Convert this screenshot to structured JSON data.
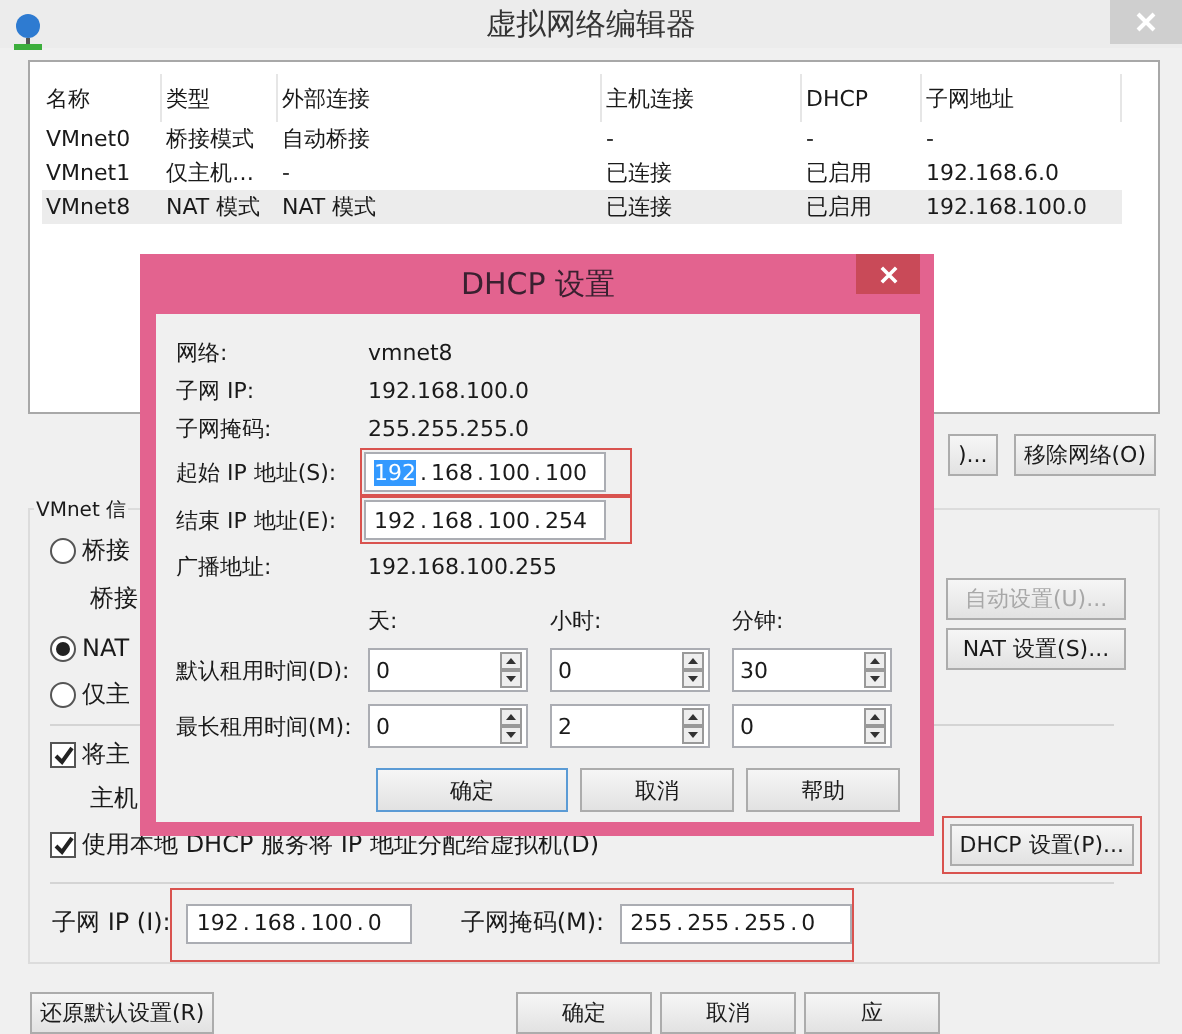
{
  "window": {
    "title": "虚拟网络编辑器"
  },
  "table": {
    "columns": [
      "名称",
      "类型",
      "外部连接",
      "主机连接",
      "DHCP",
      "子网地址"
    ],
    "rows": [
      {
        "cells": [
          "VMnet0",
          "桥接模式",
          "自动桥接",
          "-",
          "-",
          "-"
        ],
        "selected": false
      },
      {
        "cells": [
          "VMnet1",
          "仅主机…",
          "-",
          "已连接",
          "已启用",
          "192.168.6.0"
        ],
        "selected": false
      },
      {
        "cells": [
          "VMnet8",
          "NAT 模式",
          "NAT 模式",
          "已连接",
          "已启用",
          "192.168.100.0"
        ],
        "selected": true
      }
    ]
  },
  "table_buttons": [
    ")...",
    "移除网络(O)"
  ],
  "vmnet_info": {
    "title": "VMnet 信",
    "rows": [
      {
        "kind": "radio",
        "label": "桥接",
        "selected": false
      },
      {
        "kind": "label",
        "label": "桥接",
        "button": {
          "label": "自动设置(U)...",
          "disabled": true,
          "highlighted": false
        }
      },
      {
        "kind": "radio",
        "label": "NAT",
        "selected": true,
        "button": {
          "label": "NAT 设置(S)...",
          "disabled": false,
          "highlighted": false
        }
      },
      {
        "kind": "radio",
        "label": "仅主",
        "selected": false
      },
      {
        "kind": "divider"
      },
      {
        "kind": "checkbox",
        "label": "将主",
        "checked": true
      },
      {
        "kind": "label",
        "label": "主机"
      },
      {
        "kind": "checkbox",
        "label": "使用本地 DHCP 服务将 IP 地址分配给虚拟机(D)",
        "checked": true,
        "button": {
          "label": "DHCP 设置(P)...",
          "disabled": false,
          "highlighted": true
        }
      }
    ],
    "subnet": {
      "highlighted": true,
      "ip_label": "子网 IP (I):",
      "ip": {
        "octets": [
          {
            "text": "192",
            "selected": false
          },
          {
            "text": "168",
            "selected": false
          },
          {
            "text": "100",
            "selected": false
          },
          {
            "text": "0",
            "selected": false
          }
        ],
        "separator": "."
      },
      "mask_label": "子网掩码(M):",
      "mask": {
        "octets": [
          {
            "text": "255",
            "selected": false
          },
          {
            "text": "255",
            "selected": false
          },
          {
            "text": "255",
            "selected": false
          },
          {
            "text": "0",
            "selected": false
          }
        ],
        "separator": "."
      }
    }
  },
  "bottom_left_button": "还原默认设置(R)",
  "bottom_buttons": [
    "确定",
    "取消",
    "应"
  ],
  "dialog": {
    "title": "DHCP 设置",
    "info": [
      {
        "label": "网络:",
        "value": "vmnet8"
      },
      {
        "label": "子网 IP:",
        "value": "192.168.100.0"
      },
      {
        "label": "子网掩码:",
        "value": "255.255.255.0"
      }
    ],
    "ranges": [
      {
        "label": "起始 IP 地址(S):",
        "highlighted": true,
        "ip": {
          "octets": [
            {
              "text": "192",
              "selected": true
            },
            {
              "text": "168",
              "selected": false
            },
            {
              "text": "100",
              "selected": false
            },
            {
              "text": "100",
              "selected": false
            }
          ],
          "separator": "."
        }
      },
      {
        "label": "结束 IP 地址(E):",
        "highlighted": true,
        "ip": {
          "octets": [
            {
              "text": "192",
              "selected": false
            },
            {
              "text": "168",
              "selected": false
            },
            {
              "text": "100",
              "selected": false
            },
            {
              "text": "254",
              "selected": false
            }
          ],
          "separator": "."
        }
      }
    ],
    "broadcast": {
      "label": "广播地址:",
      "value": "192.168.100.255"
    },
    "lease_columns": [
      "天:",
      "小时:",
      "分钟:"
    ],
    "leases": [
      {
        "label": "默认租用时间(D):",
        "values": [
          "0",
          "0",
          "30"
        ]
      },
      {
        "label": "最长租用时间(M):",
        "values": [
          "0",
          "2",
          "0"
        ]
      }
    ],
    "buttons": [
      {
        "label": "确定",
        "focused": true
      },
      {
        "label": "取消",
        "focused": false
      },
      {
        "label": "帮助",
        "focused": false
      }
    ]
  }
}
